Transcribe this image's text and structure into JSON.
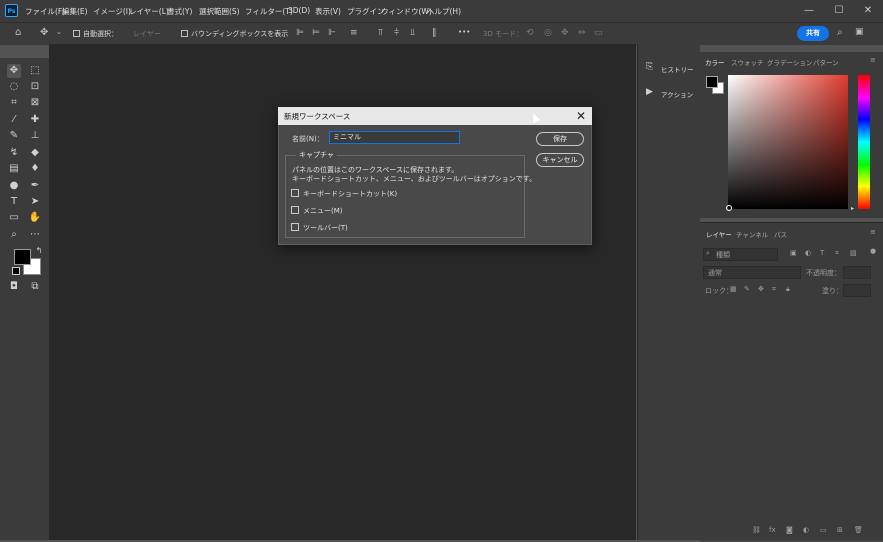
{
  "app": {
    "logo": "Ps"
  },
  "menubar": {
    "items": [
      "ファイル(F)",
      "編集(E)",
      "イメージ(I)",
      "レイヤー(L)",
      "書式(Y)",
      "選択範囲(S)",
      "フィルター(T)",
      "3D(D)",
      "表示(V)",
      "プラグイン",
      "ウィンドウ(W)",
      "ヘルプ(H)"
    ],
    "window_controls": [
      "—",
      "☐",
      "✕"
    ]
  },
  "options_bar": {
    "auto_select_label": "自動選択：",
    "auto_select_value": "レイヤー",
    "bounding_box_label": "バウンディングボックスを表示",
    "mode_3d_label": "3D モード：",
    "share_label": "共有",
    "more_label": "•••"
  },
  "strip": {
    "history_label": "ヒストリー",
    "actions_label": "アクション"
  },
  "color_panel": {
    "tabs": [
      "カラー",
      "スウォッチ",
      "グラデーション",
      "パターン"
    ],
    "foreground": "#000000",
    "background": "#ffffff",
    "hue": "#e03b2e"
  },
  "layers_panel": {
    "tabs": [
      "レイヤー",
      "チャンネル",
      "パス"
    ],
    "filter_placeholder": "種類",
    "blend_mode": "通常",
    "opacity_label": "不透明度：",
    "lock_label": "ロック：",
    "fill_label": "塗り："
  },
  "dialog": {
    "title": "新規ワークスペース",
    "name_label": "名前(N)：",
    "name_value": "ミニマル",
    "capture_legend": "キャプチャ",
    "desc_line1": "パネルの位置はこのワークスペースに保存されます。",
    "desc_line2": "キーボードショートカット、メニュー、およびツールバーはオプションです。",
    "checkboxes": [
      {
        "label": "キーボードショートカット(K)",
        "checked": false
      },
      {
        "label": "メニュー(M)",
        "checked": false
      },
      {
        "label": "ツールバー(T)",
        "checked": false
      }
    ],
    "save_label": "保存",
    "cancel_label": "キャンセル"
  }
}
